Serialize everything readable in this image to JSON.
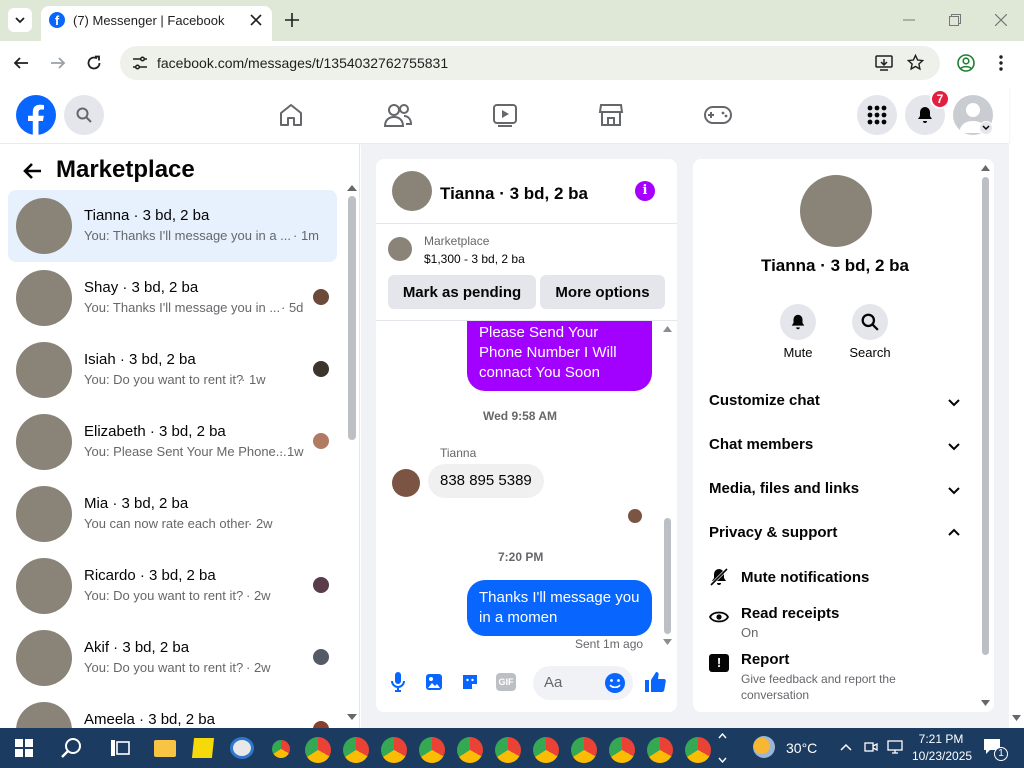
{
  "browser": {
    "tab_title": "(7) Messenger | Facebook",
    "url": "facebook.com/messages/t/1354032762755831"
  },
  "fb": {
    "notification_count": "7",
    "brand_color": "#0866ff"
  },
  "left": {
    "title": "Marketplace",
    "conversations": [
      {
        "name": "Tianna · 3 bd, 2 ba",
        "preview": "You: Thanks I'll message you in a ...",
        "time": "· 1m"
      },
      {
        "name": "Shay · 3 bd, 2 ba",
        "preview": "You: Thanks I'll message you in ...",
        "time": "· 5d"
      },
      {
        "name": "Isiah · 3 bd, 2 ba",
        "preview": "You: Do you want to rent it?",
        "time": "· 1w"
      },
      {
        "name": "Elizabeth · 3 bd, 2 ba",
        "preview": "You: Please Sent Your Me Phone...",
        "time": "· 1w"
      },
      {
        "name": "Mia · 3 bd, 2 ba",
        "preview": "You can now rate each other",
        "time": "· 2w"
      },
      {
        "name": "Ricardo · 3 bd, 2 ba",
        "preview": "You: Do you want to rent it?",
        "time": "· 2w"
      },
      {
        "name": "Akif · 3 bd, 2 ba",
        "preview": "You: Do you want to rent it?",
        "time": "· 2w"
      },
      {
        "name": "Ameela · 3 bd, 2 ba",
        "preview": "",
        "time": ""
      }
    ]
  },
  "chat": {
    "title": "Tianna · 3 bd, 2 ba",
    "listing_source": "Marketplace",
    "listing_price": "$1,300 - 3 bd, 2 ba",
    "mark_pending_label": "Mark as pending",
    "more_options_label": "More options",
    "msg_top": "Please Send Your Phone Number I Will connact You Soon",
    "ts1": "Wed 9:58 AM",
    "sender_name": "Tianna",
    "incoming_msg": "838 895 5389",
    "ts2": "7:20 PM",
    "msg_out": "Thanks I'll message you in a momen",
    "sent_status": "Sent 1m ago",
    "composer_placeholder": "Aa"
  },
  "info": {
    "title": "Tianna · 3 bd, 2 ba",
    "mute_label": "Mute",
    "search_label": "Search",
    "customize_chat": "Customize chat",
    "chat_members": "Chat members",
    "media_files": "Media, files and links",
    "privacy_support": "Privacy & support",
    "mute_notifications": "Mute notifications",
    "read_receipts": "Read receipts",
    "read_receipts_state": "On",
    "report": "Report",
    "report_desc": "Give feedback and report the conversation"
  },
  "taskbar": {
    "temperature": "30°C",
    "time": "7:21 PM",
    "date": "10/23/2025",
    "notification_count": "1"
  }
}
